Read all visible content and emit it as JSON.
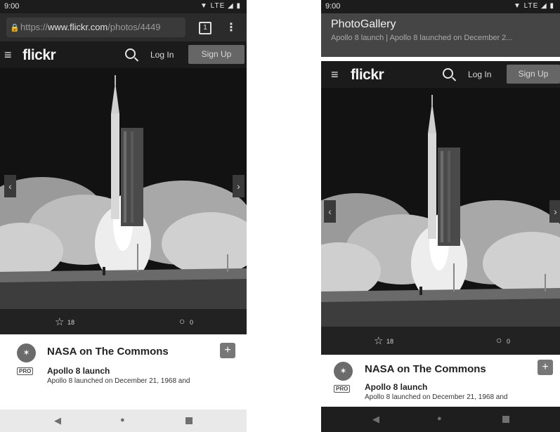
{
  "left_phone": {
    "status": {
      "time": "9:00",
      "indicators": "▼ LTE ◢ ▮"
    },
    "browser": {
      "lock_icon": "lock-icon",
      "url_scheme": "https://",
      "url_host": "www.flickr.com",
      "url_path": "/photos/4449",
      "tab_count": "1",
      "menu_icon": "⋮"
    },
    "nav": {
      "logo": "flickr",
      "login": "Log In",
      "signup": "Sign Up"
    },
    "stats": {
      "faves": "18",
      "comments": "0"
    },
    "info": {
      "owner": "NASA on The Commons",
      "pro_badge": "PRO",
      "photo_title": "Apollo 8 launch",
      "photo_desc": "Apollo 8 launched on December 21, 1968 and"
    }
  },
  "right_phone": {
    "status": {
      "time": "9:00",
      "indicators": "▼ LTE ◢ ▮"
    },
    "app": {
      "title": "PhotoGallery",
      "subtitle": "Apollo 8 launch | Apollo 8 launched on December 2..."
    },
    "nav": {
      "logo": "flickr",
      "login": "Log In",
      "signup": "Sign Up"
    },
    "stats": {
      "faves": "18",
      "comments": "0"
    },
    "info": {
      "owner": "NASA on The Commons",
      "pro_badge": "PRO",
      "photo_title": "Apollo 8 launch",
      "photo_desc": "Apollo 8 launched on December 21, 1968 and"
    }
  },
  "icons": {
    "hamburger": "≡",
    "chevron_left": "‹",
    "chevron_right": "›",
    "star": "☆",
    "comment": "○",
    "plus": "+",
    "back": "◀",
    "home": "●"
  }
}
